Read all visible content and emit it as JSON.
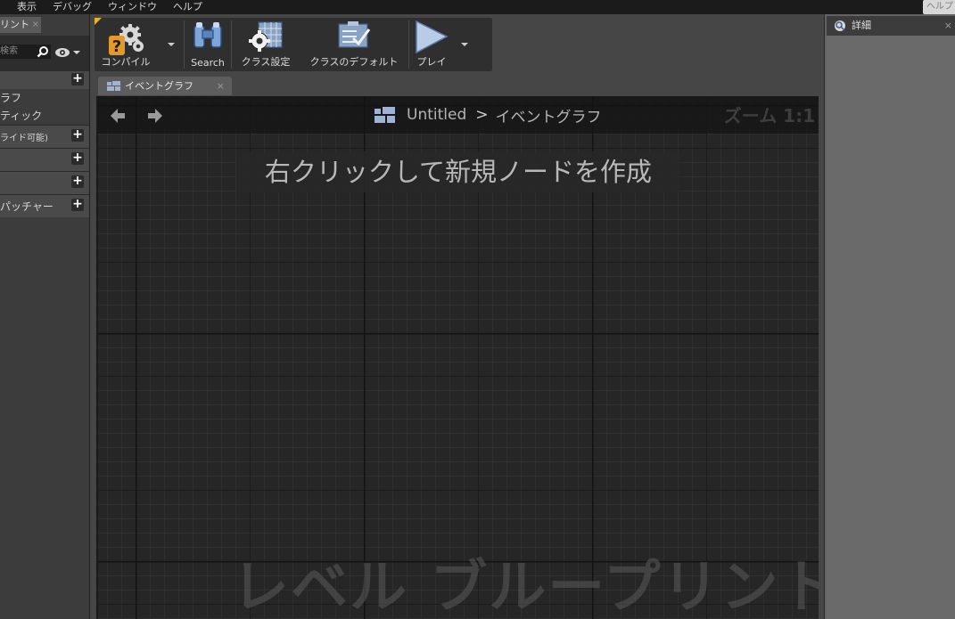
{
  "menubar": {
    "items": [
      "表示",
      "デバッグ",
      "ウィンドウ",
      "ヘルプ"
    ],
    "help_search_placeholder": "ヘルプ"
  },
  "left_panel": {
    "tab_label": "リント",
    "tab_close": "×",
    "search_placeholder": "検索",
    "rows": [
      {
        "label": "",
        "kind": "header"
      },
      {
        "label": "ラフ",
        "kind": "item"
      },
      {
        "label": "ティック",
        "kind": "item"
      },
      {
        "label": "ライド可能)",
        "kind": "section"
      },
      {
        "label": "",
        "kind": "section"
      },
      {
        "label": "",
        "kind": "section"
      },
      {
        "label": "パッチャー",
        "kind": "section"
      }
    ]
  },
  "toolbar": {
    "compile_label": "コンパイル",
    "search_label": "Search",
    "class_settings_label": "クラス設定",
    "class_defaults_label": "クラスのデフォルト",
    "play_label": "プレイ"
  },
  "graph_tab": {
    "label": "イベントグラフ",
    "close": "×"
  },
  "graph": {
    "breadcrumb_root": "Untitled",
    "breadcrumb_sep": ">",
    "breadcrumb_current": "イベントグラフ",
    "zoom": "ズーム 1:1",
    "hint": "右クリックして新規ノードを作成",
    "watermark": "レベル ブループリント"
  },
  "details_panel": {
    "tab_label": "詳細",
    "close": "×"
  },
  "colors": {
    "accent_yellow": "#e7b431",
    "graph_bg": "#262626",
    "panel_bg": "#3c3c3c"
  }
}
